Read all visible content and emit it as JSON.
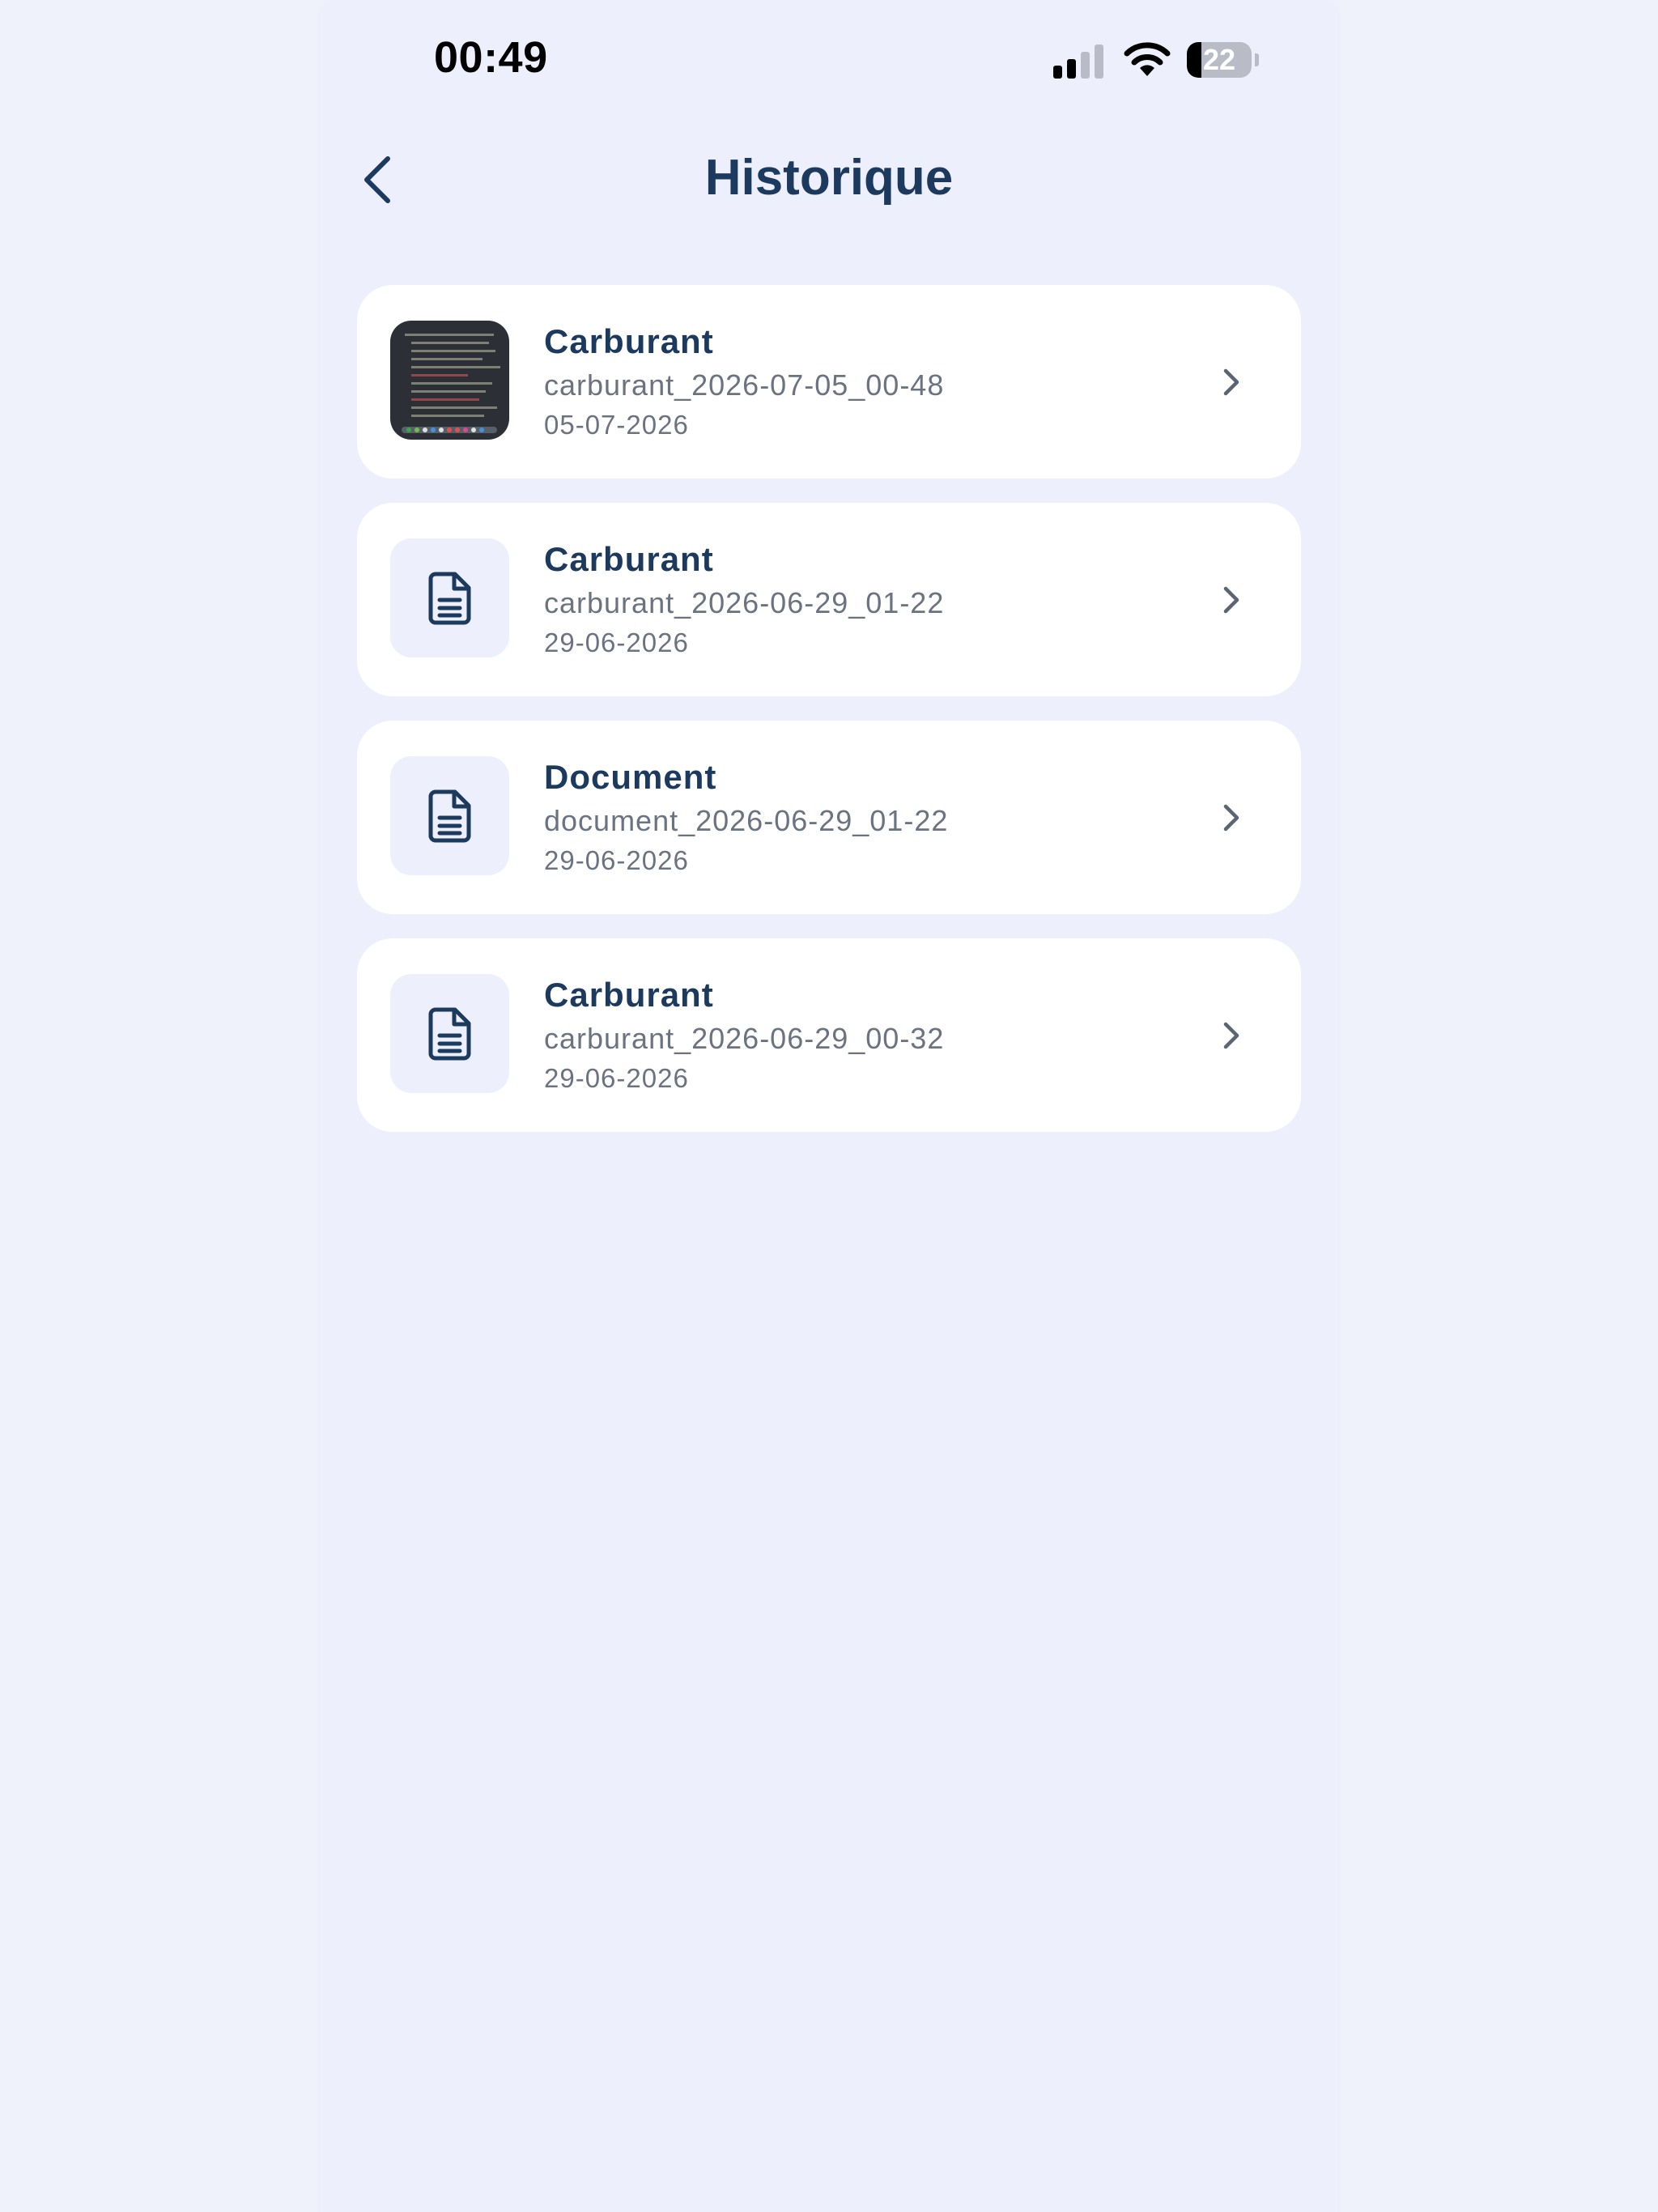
{
  "status_bar": {
    "time": "00:49",
    "battery_level": "22",
    "battery_fraction": 0.22
  },
  "header": {
    "title": "Historique",
    "back_icon": "chevron-left-icon"
  },
  "history": {
    "items": [
      {
        "title": "Carburant",
        "filename": "carburant_2026-07-05_00-48",
        "date": "05-07-2026",
        "thumbnail": "photo"
      },
      {
        "title": "Carburant",
        "filename": "carburant_2026-06-29_01-22",
        "date": "29-06-2026",
        "thumbnail": "document-icon"
      },
      {
        "title": "Document",
        "filename": "document_2026-06-29_01-22",
        "date": "29-06-2026",
        "thumbnail": "document-icon"
      },
      {
        "title": "Carburant",
        "filename": "carburant_2026-06-29_00-32",
        "date": "29-06-2026",
        "thumbnail": "document-icon"
      }
    ]
  },
  "colors": {
    "background": "#edf0fc",
    "card": "#ffffff",
    "primary_text": "#1c3a5e",
    "secondary_text": "#6b7280"
  }
}
